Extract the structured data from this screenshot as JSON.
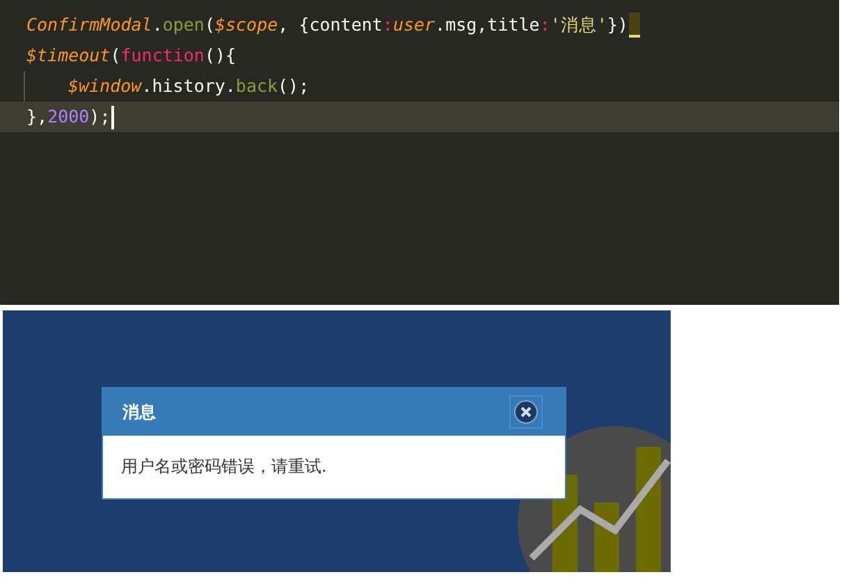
{
  "editor": {
    "lines": [
      {
        "current": false,
        "indented": false,
        "marker": true,
        "tokens": [
          {
            "text": "ConfirmModal",
            "kind": "var"
          },
          {
            "text": ".",
            "kind": "plain"
          },
          {
            "text": "open",
            "kind": "func"
          },
          {
            "text": "(",
            "kind": "plain"
          },
          {
            "text": "$scope",
            "kind": "var"
          },
          {
            "text": ", {content",
            "kind": "plain"
          },
          {
            "text": ":",
            "kind": "op"
          },
          {
            "text": "user",
            "kind": "var"
          },
          {
            "text": ".msg,title",
            "kind": "plain"
          },
          {
            "text": ":",
            "kind": "op"
          },
          {
            "text": "'消息'",
            "kind": "string"
          },
          {
            "text": "})",
            "kind": "plain"
          }
        ]
      },
      {
        "current": false,
        "indented": false,
        "marker": false,
        "tokens": [
          {
            "text": "$timeout",
            "kind": "var"
          },
          {
            "text": "(",
            "kind": "plain"
          },
          {
            "text": "function",
            "kind": "keyword"
          },
          {
            "text": "(){",
            "kind": "plain"
          }
        ]
      },
      {
        "current": false,
        "indented": true,
        "marker": false,
        "tokens": [
          {
            "text": "$window",
            "kind": "var"
          },
          {
            "text": ".history.",
            "kind": "plain"
          },
          {
            "text": "back",
            "kind": "func"
          },
          {
            "text": "();",
            "kind": "plain"
          }
        ]
      },
      {
        "current": true,
        "indented": false,
        "marker": false,
        "tokens": [
          {
            "text": "},",
            "kind": "plain"
          },
          {
            "text": "2000",
            "kind": "number"
          },
          {
            "text": ");",
            "kind": "plain"
          }
        ]
      }
    ]
  },
  "modal": {
    "title": "消息",
    "message": "用户名或密码错误，请重试."
  }
}
